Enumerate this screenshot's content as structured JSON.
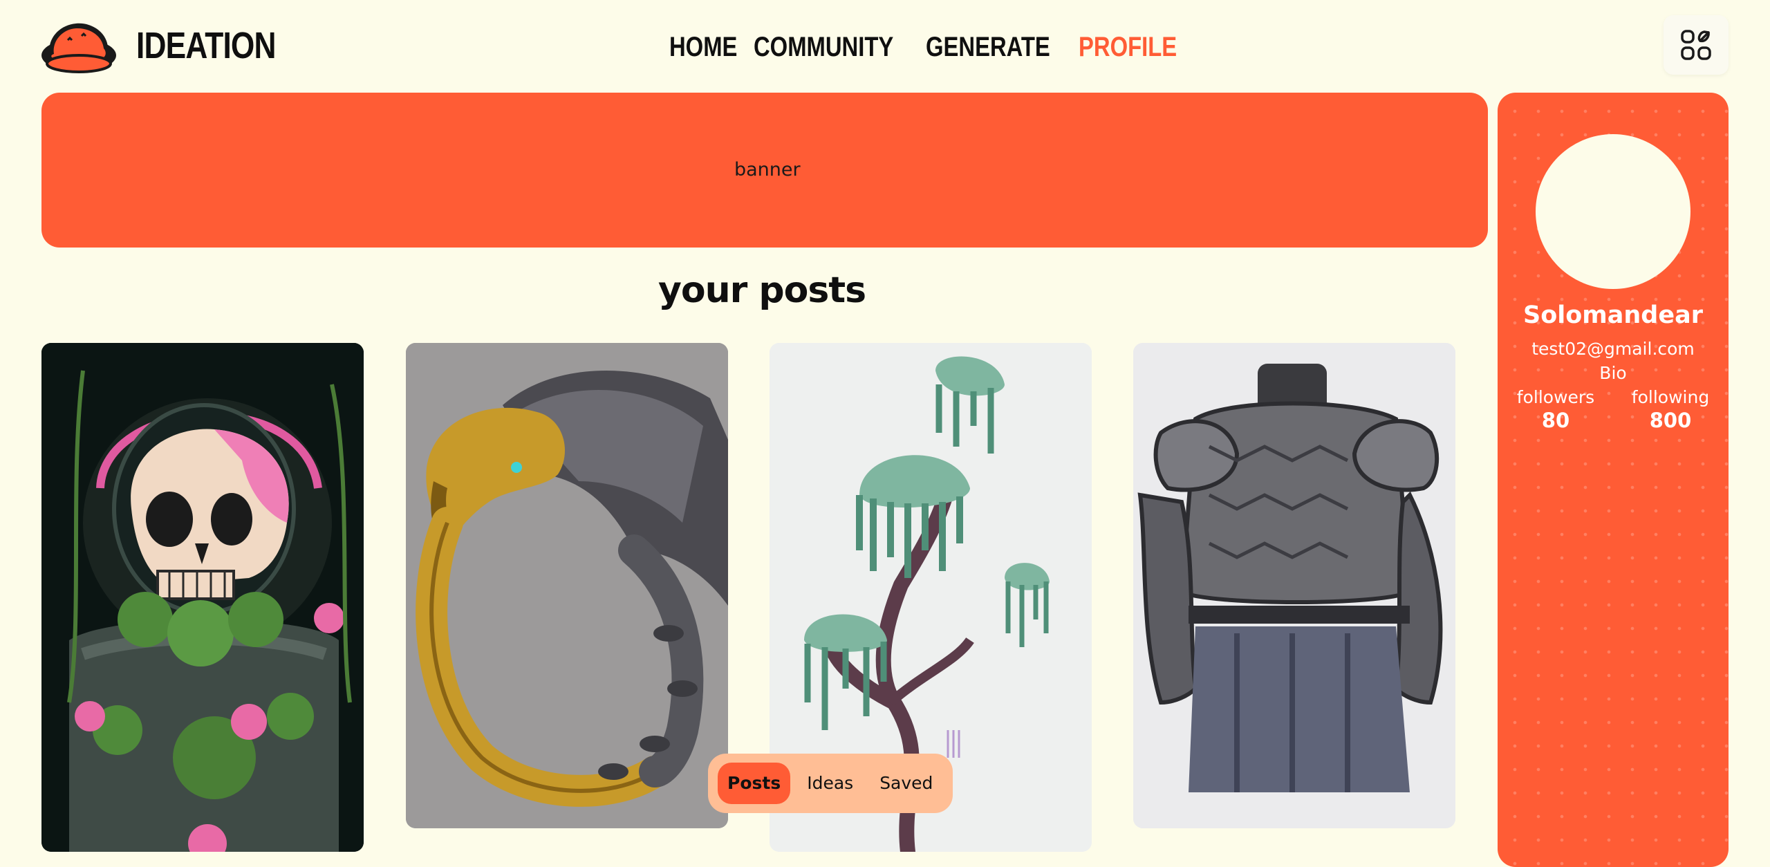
{
  "header": {
    "brand": "IDEATION",
    "nav": [
      {
        "label": "HOME"
      },
      {
        "label": "COMMUNITY"
      },
      {
        "label": "GENERATE"
      },
      {
        "label": "PROFILE",
        "active": true
      }
    ],
    "apps_icon": "grid-icon"
  },
  "banner": {
    "label": "banner"
  },
  "posts": {
    "title": "your posts",
    "items": [
      {
        "image": "skull-astronaut-with-flowers"
      },
      {
        "image": "golden-eagle-ring"
      },
      {
        "image": "willow-tree-sketch"
      },
      {
        "image": "plate-armor-concept"
      }
    ]
  },
  "tabs": [
    {
      "label": "Posts",
      "active": true
    },
    {
      "label": "Ideas"
    },
    {
      "label": "Saved"
    }
  ],
  "profile": {
    "name": "Solomandear",
    "email": "test02@gmail.com",
    "bio": "Bio",
    "followers_label": "followers",
    "followers": "80",
    "following_label": "following",
    "following": "800"
  },
  "colors": {
    "accent": "#ff5c35",
    "background": "#fdfce9",
    "tab_pill": "#ffbe95"
  }
}
